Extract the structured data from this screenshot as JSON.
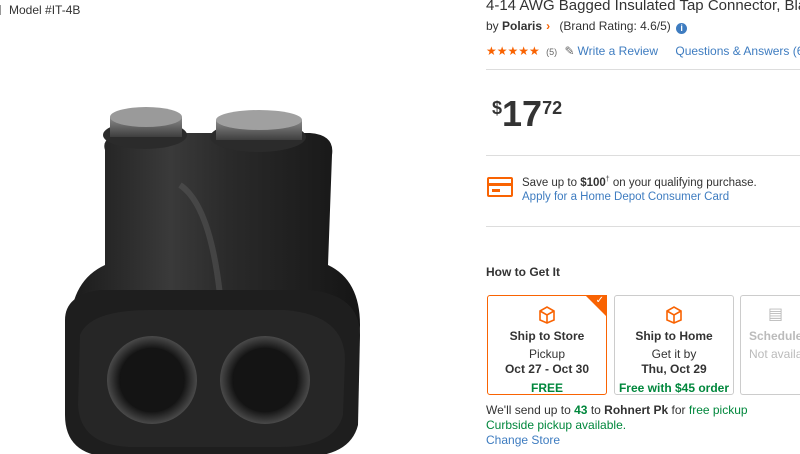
{
  "product": {
    "model": "Model #IT-4B",
    "title": "4-14 AWG Bagged Insulated Tap Connector, Bla",
    "by": "by",
    "brand": "Polaris",
    "brand_rating": "(Brand Rating: 4.6/5)",
    "stars": "★★★★★",
    "rating_value": 5,
    "review_count": "(5)",
    "write_review": "Write a Review",
    "questions": "Questions & Answers (6"
  },
  "price": {
    "currency": "$",
    "dollars": "17",
    "cents": "72"
  },
  "promo": {
    "save_prefix": "Save up to ",
    "save_amount": "$100",
    "save_sup": "†",
    "save_suffix": " on your qualifying purchase.",
    "apply_link": "Apply for a Home Depot Consumer Card"
  },
  "fulfillment": {
    "heading": "How to Get It",
    "options": [
      {
        "title": "Ship to Store",
        "sub": "Pickup",
        "date": "Oct 27 - Oct 30",
        "price": "FREE",
        "icon": "store-box-icon",
        "selected": true
      },
      {
        "title": "Ship to Home",
        "sub": "Get it by",
        "date": "Thu, Oct 29",
        "price": "Free with $45 order",
        "icon": "box-icon",
        "selected": false
      },
      {
        "title": "Schedule",
        "sub": "Not availa",
        "icon": "calendar-icon",
        "selected": false
      }
    ],
    "note_prefix": "We'll send up to ",
    "note_qty": "43",
    "note_mid": " to ",
    "note_store": "Rohnert Pk",
    "note_for": " for ",
    "note_free": "free pickup",
    "curbside": "Curbside pickup available.",
    "change_store": "Change Store"
  },
  "colors": {
    "accent": "#f96302",
    "link": "#3e7cc0",
    "green": "#00873c"
  }
}
